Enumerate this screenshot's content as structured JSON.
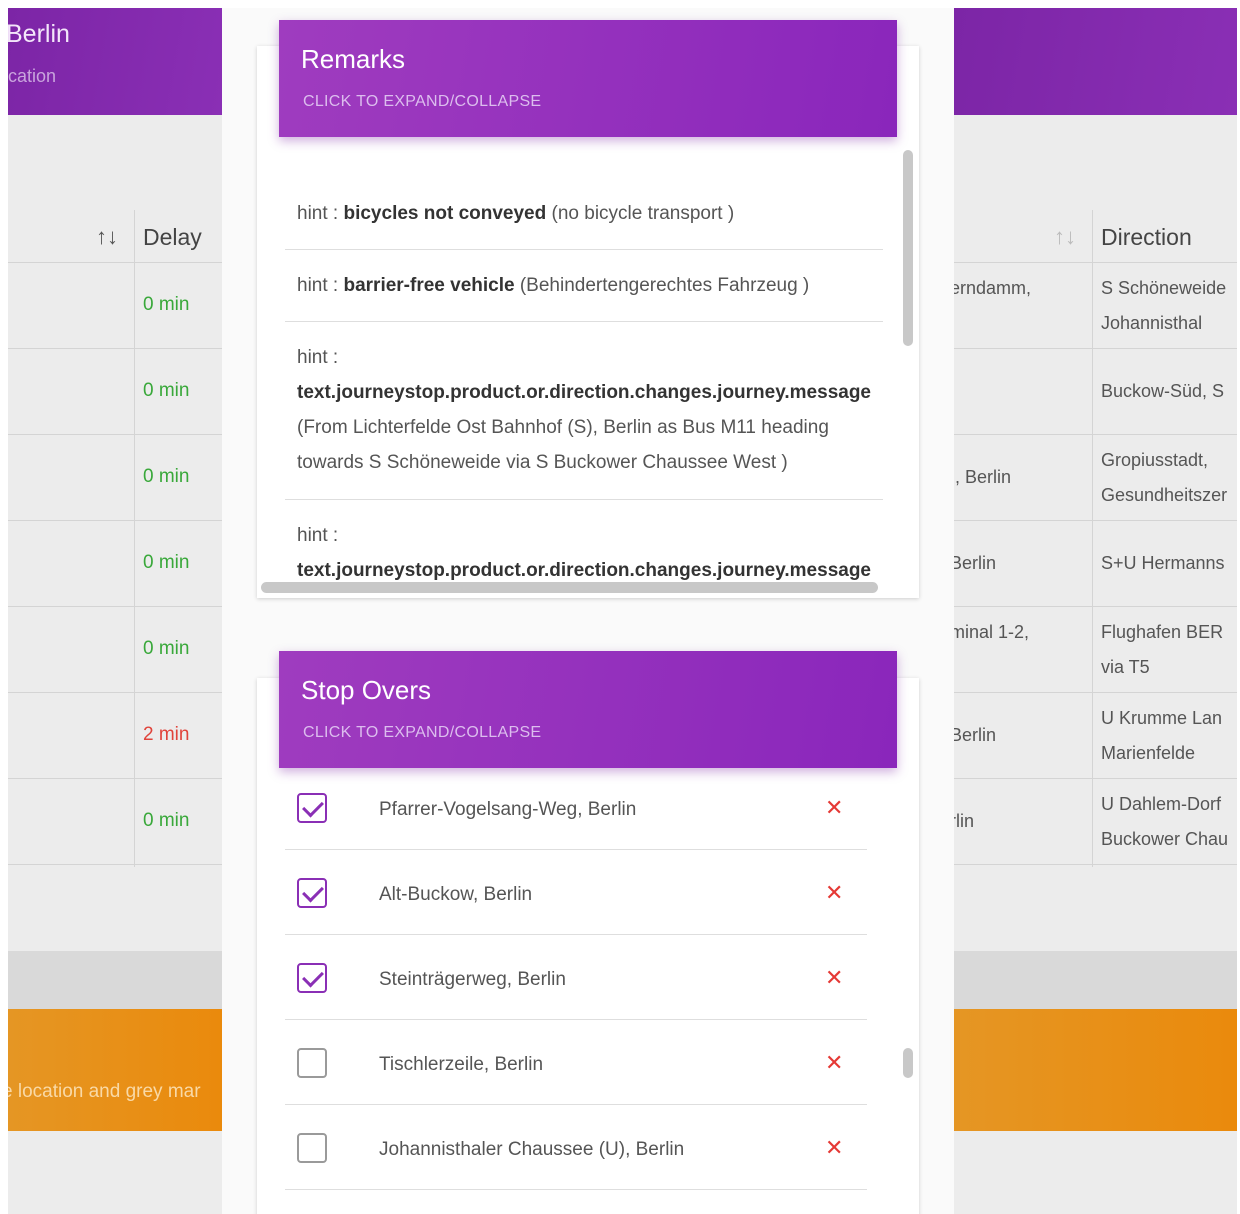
{
  "background": {
    "left_header": {
      "title": "Berlin",
      "subtitle": "cation"
    },
    "left_table": {
      "sort_icon": "↑↓",
      "delay_header": "Delay",
      "delays": [
        "0 min",
        "0 min",
        "0 min",
        "0 min",
        "0 min",
        "2 min",
        "0 min"
      ]
    },
    "right_table": {
      "sort_icon": "↑↓",
      "direction_header": "Direction",
      "rows": [
        {
          "stop": "erndamm,",
          "direction_1": "S Schöneweide",
          "direction_2": "Johannisthal"
        },
        {
          "stop": "ı",
          "direction_1": "Buckow-Süd, S",
          "direction_2": ""
        },
        {
          "stop": "ı, Berlin",
          "direction_1": "Gropiusstadt,",
          "direction_2": "Gesundheitszer"
        },
        {
          "stop": "Berlin",
          "direction_1": "S+U Hermanns",
          "direction_2": ""
        },
        {
          "stop": "minal 1-2,",
          "direction_1": "Flughafen BER",
          "direction_2": "via T5"
        },
        {
          "stop": "Berlin",
          "direction_1": "U Krumme Lan",
          "direction_2": "Marienfelde"
        },
        {
          "stop": "rlin",
          "direction_1": "U Dahlem-Dorf",
          "direction_2": "Buckower Chau"
        }
      ]
    },
    "legend_text": "e location and grey mar"
  },
  "remarks": {
    "title": "Remarks",
    "subtitle": "CLICK TO EXPAND/COLLAPSE",
    "items": [
      {
        "prefix": "hint : ",
        "bold": "bicycles not conveyed",
        "rest": " (no bicycle transport )"
      },
      {
        "prefix": "hint : ",
        "bold": "barrier-free vehicle",
        "rest": " (Behindertengerechtes Fahrzeug )"
      },
      {
        "prefix": "hint :",
        "bold": "text.journeystop.product.or.direction.changes.journey.message",
        "rest_1": "(From Lichterfelde Ost Bahnhof (S), Berlin as Bus M11 heading",
        "rest_2": "towards S Schöneweide via S Buckower Chaussee West )"
      },
      {
        "prefix": "hint :",
        "bold": "text.journeystop.product.or.direction.changes.journey.message"
      }
    ]
  },
  "stop_overs": {
    "title": "Stop Overs",
    "subtitle": "CLICK TO EXPAND/COLLAPSE",
    "delete_icon": "✕",
    "items": [
      {
        "name": "Pfarrer-Vogelsang-Weg, Berlin",
        "checked": true
      },
      {
        "name": "Alt-Buckow, Berlin",
        "checked": true
      },
      {
        "name": "Steinträgerweg, Berlin",
        "checked": true
      },
      {
        "name": "Tischlerzeile, Berlin",
        "checked": false
      },
      {
        "name": "Johannisthaler Chaussee (U), Berlin",
        "checked": false
      }
    ]
  }
}
